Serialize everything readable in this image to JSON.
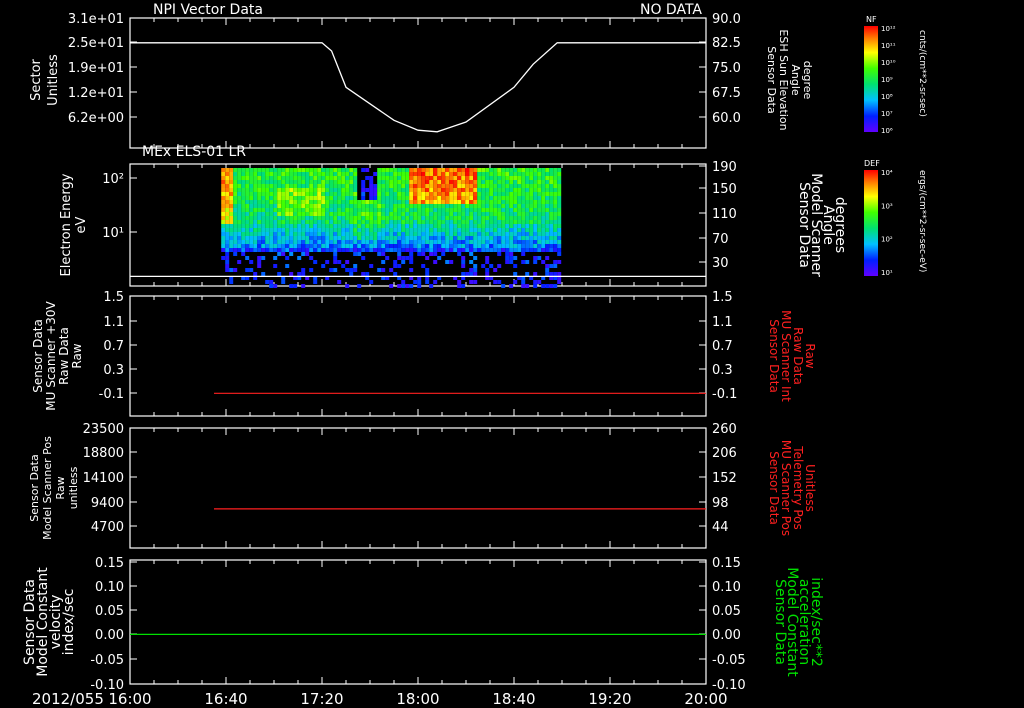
{
  "chart_data": [
    {
      "type": "line",
      "title": "NPI Vector Data",
      "status": "NO DATA",
      "ylabel": [
        "Sector",
        "Unitless"
      ],
      "yticks_left": [
        "3.1e+01",
        "2.5e+01",
        "1.9e+01",
        "1.2e+01",
        "6.2e+00"
      ],
      "ylabel_right": [
        "Sensor Data",
        "ESH Sun Elevation",
        "Angle",
        "degree"
      ],
      "yticks_right": [
        "90.0",
        "82.5",
        "75.0",
        "67.5",
        "60.0"
      ],
      "ylim_right": [
        52.5,
        90
      ],
      "series": [
        {
          "name": "ESH Sun Elevation Angle",
          "color": "#ffffff",
          "x": [
            "16:00",
            "17:20",
            "17:24",
            "17:30",
            "17:50",
            "18:00",
            "18:08",
            "18:20",
            "18:40",
            "18:48",
            "18:58",
            "19:20",
            "20:00"
          ],
          "values": [
            82.5,
            82.5,
            80,
            69,
            59,
            56,
            55.5,
            58.5,
            69,
            76,
            82.5,
            82.5,
            82.5
          ]
        }
      ],
      "colorbar": {
        "label": "NF",
        "unit": "cnts/(cm**2-sr-sec)",
        "ticks": [
          "10¹²",
          "10¹¹",
          "10¹⁰",
          "10⁹",
          "10⁸",
          "10⁷",
          "10⁶"
        ]
      }
    },
    {
      "type": "heatmap",
      "title": "MEx ELS-01 LR",
      "ylabel": [
        "Electron Energy",
        "eV"
      ],
      "yticks_left": [
        "10²",
        "10¹"
      ],
      "ylabel_right": [
        "Sensor Data",
        "Model Scanner",
        "Angle",
        "degrees"
      ],
      "yticks_right": [
        "190",
        "150",
        "110",
        "70",
        "30"
      ],
      "ylim_right": [
        0,
        190
      ],
      "scanner_angle_line": 15,
      "data_x_range": [
        "16:38",
        "18:59"
      ],
      "colorbar": {
        "label": "DEF",
        "unit": "ergs/(cm**2-sr-sec-eV)",
        "ticks": [
          "10⁴",
          "10³",
          "10²",
          "10¹"
        ]
      }
    },
    {
      "type": "line",
      "ylabel": [
        "Sensor Data",
        "MU Scanner +30V",
        "Raw Data",
        "Raw"
      ],
      "yticks_left": [
        "1.5",
        "1.1",
        "0.7",
        "0.3",
        "-0.1"
      ],
      "ylabel_right": [
        "Sensor Data",
        "MU Scanner Int",
        "Raw Data",
        "Raw"
      ],
      "yticks_right": [
        "1.5",
        "1.1",
        "0.7",
        "0.3",
        "-0.1"
      ],
      "ylim": [
        -0.35,
        1.5
      ],
      "series": [
        {
          "name": "MU Scanner Int Raw Data",
          "color": "#ff2020",
          "x": [
            "16:35",
            "20:00"
          ],
          "values": [
            0,
            0
          ]
        }
      ]
    },
    {
      "type": "line",
      "ylabel": [
        "Sensor Data",
        "Model Scanner Pos",
        "Raw",
        "unitless"
      ],
      "yticks_left": [
        "23500",
        "18800",
        "14100",
        "9400",
        "4700"
      ],
      "ylabel_right": [
        "Sensor Data",
        "MU Scanner Pos",
        "Telemetry Pos",
        "Unitless"
      ],
      "yticks_right": [
        "260",
        "206",
        "152",
        "98",
        "44"
      ],
      "ylim": [
        0,
        23500
      ],
      "series": [
        {
          "name": "MU Scanner Pos Telemetry Pos",
          "color": "#ff2020",
          "x": [
            "16:35",
            "20:00"
          ],
          "values": [
            7650,
            7650
          ]
        }
      ]
    },
    {
      "type": "line",
      "ylabel": [
        "Sensor Data",
        "Model Constant",
        "velocity",
        "index/sec"
      ],
      "yticks_left": [
        "0.15",
        "0.10",
        "0.05",
        "0.00",
        "-0.05",
        "-0.10"
      ],
      "ylabel_right": [
        "Sensor Data",
        "Model Constant",
        "acceleration",
        "index/sec**2"
      ],
      "yticks_right": [
        "0.15",
        "0.10",
        "0.05",
        "0.00",
        "-0.05",
        "-0.10"
      ],
      "ylim": [
        -0.1,
        0.15
      ],
      "series": [
        {
          "name": "Model Constant acceleration",
          "color": "#00e000",
          "x": [
            "16:00",
            "20:00"
          ],
          "values": [
            0,
            0
          ]
        }
      ]
    }
  ],
  "x_axis": {
    "date_label": "2012/055",
    "ticks": [
      "16:00",
      "16:40",
      "17:20",
      "18:00",
      "18:40",
      "19:20",
      "20:00"
    ]
  },
  "colors": {
    "right_label_panel1": "#ffffff",
    "right_label_panel3": "#ff2020",
    "right_label_panel4": "#ff2020",
    "right_label_panel5": "#00e000"
  }
}
